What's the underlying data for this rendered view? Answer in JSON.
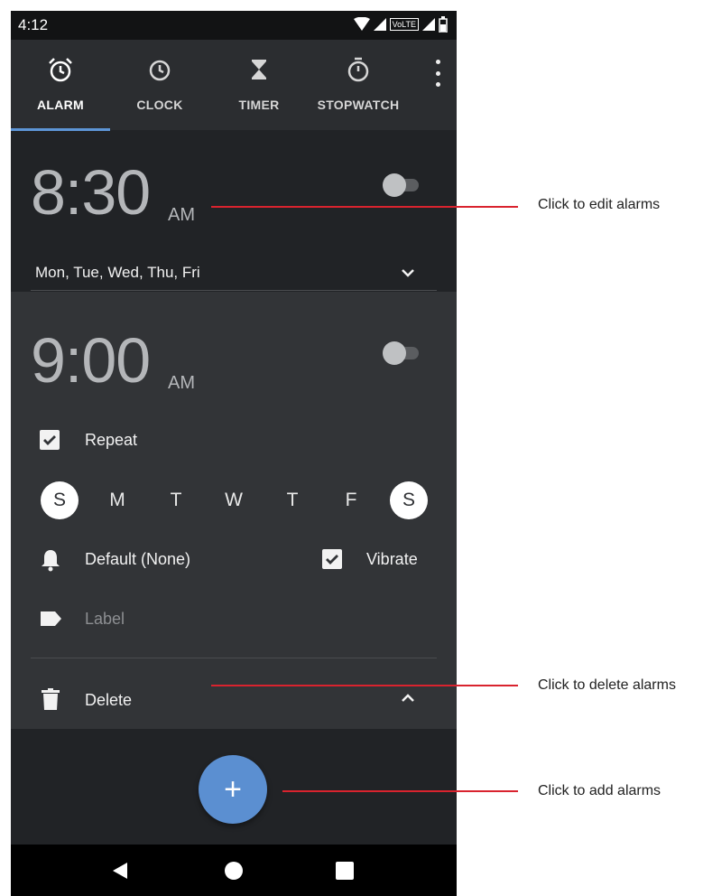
{
  "status_bar": {
    "time": "4:12",
    "network_label": "VoLTE"
  },
  "tabs": [
    {
      "label": "ALARM",
      "icon": "alarm-clock-icon",
      "active": true
    },
    {
      "label": "CLOCK",
      "icon": "clock-icon",
      "active": false
    },
    {
      "label": "TIMER",
      "icon": "hourglass-icon",
      "active": false
    },
    {
      "label": "STOPWATCH",
      "icon": "stopwatch-icon",
      "active": false
    }
  ],
  "alarms": [
    {
      "time": "8:30",
      "ampm": "AM",
      "days": "Mon, Tue, Wed, Thu, Fri",
      "enabled": false
    },
    {
      "time": "9:00",
      "ampm": "AM",
      "enabled": false,
      "repeat_label": "Repeat",
      "repeat_checked": true,
      "week_days": [
        {
          "letter": "S",
          "selected": true
        },
        {
          "letter": "M",
          "selected": false
        },
        {
          "letter": "T",
          "selected": false
        },
        {
          "letter": "W",
          "selected": false
        },
        {
          "letter": "T",
          "selected": false
        },
        {
          "letter": "F",
          "selected": false
        },
        {
          "letter": "S",
          "selected": true
        }
      ],
      "ringtone_label": "Default (None)",
      "vibrate_label": "Vibrate",
      "vibrate_checked": true,
      "label_placeholder": "Label",
      "delete_label": "Delete"
    }
  ],
  "fab": {
    "symbol": "+"
  },
  "annotations": {
    "edit": "Click to edit alarms",
    "delete": "Click to delete alarms",
    "add": "Click to add alarms"
  },
  "colors": {
    "accent": "#5b8fd1",
    "annotation": "#d9232e",
    "background": "#212326",
    "card_expanded": "#323437"
  }
}
